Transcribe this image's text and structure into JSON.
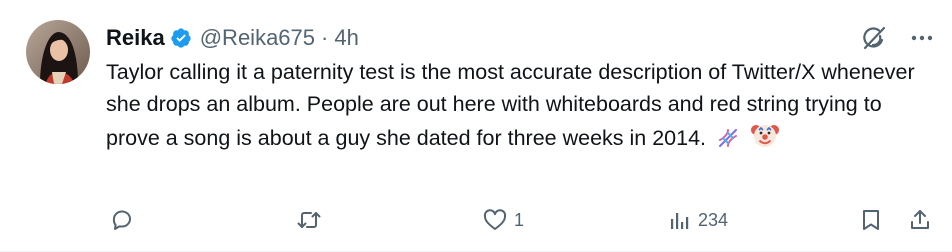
{
  "tweet": {
    "display_name": "Reika",
    "handle": "@Reika675",
    "separator": "·",
    "time": "4h",
    "text": "Taylor calling it a paternity test is the most accurate description of Twitter/X whenever she drops an album. People are out here with whiteboards and red string trying to prove a song is about a guy she dated for three weeks in 2014.",
    "emojis": [
      "dna-emoji",
      "clown-face-emoji"
    ],
    "verified": true,
    "top_icons": [
      "grok-icon",
      "more-icon"
    ]
  },
  "actions": {
    "reply_count": "",
    "retweet_count": "",
    "like_count": "1",
    "views_count": "234",
    "bookmark": "bookmark-icon",
    "share": "share-icon"
  },
  "colors": {
    "text": "#0f1419",
    "secondary": "#536471",
    "verified": "#1d9bf0"
  }
}
